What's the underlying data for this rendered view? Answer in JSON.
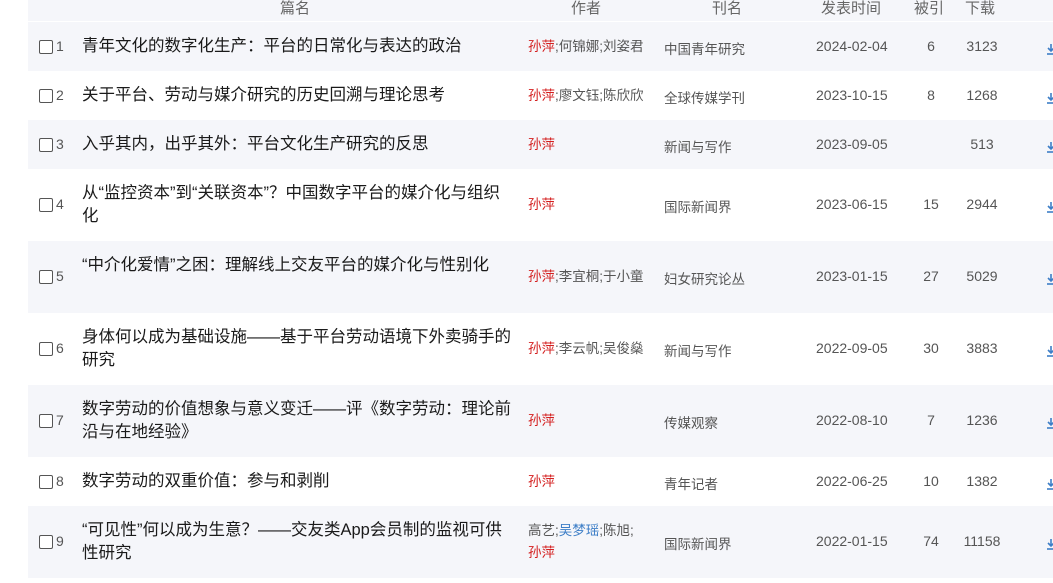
{
  "header": {
    "title": "篇名",
    "authors": "作者",
    "source": "刊名",
    "date": "发表时间",
    "cited": "被引",
    "downloads": "下载"
  },
  "rows": [
    {
      "num": "1",
      "title": "青年文化的数字化生产：平台的日常化与表达的政治",
      "authors": [
        {
          "name": "孙萍",
          "color": "red"
        },
        {
          "name": "何锦娜",
          "color": "gray"
        },
        {
          "name": "刘姿君",
          "color": "gray"
        }
      ],
      "source": "中国青年研究",
      "date": "2024-02-04",
      "cited": "6",
      "downloads": "3123"
    },
    {
      "num": "2",
      "title": "关于平台、劳动与媒介研究的历史回溯与理论思考",
      "authors": [
        {
          "name": "孙萍",
          "color": "red"
        },
        {
          "name": "廖文钰",
          "color": "gray"
        },
        {
          "name": "陈欣欣",
          "color": "gray"
        }
      ],
      "source": "全球传媒学刊",
      "date": "2023-10-15",
      "cited": "8",
      "downloads": "1268"
    },
    {
      "num": "3",
      "title": "入乎其内，出乎其外：平台文化生产研究的反思",
      "authors": [
        {
          "name": "孙萍",
          "color": "red"
        }
      ],
      "source": "新闻与写作",
      "date": "2023-09-05",
      "cited": "",
      "downloads": "513"
    },
    {
      "num": "4",
      "title": "从“监控资本”到“关联资本”？中国数字平台的媒介化与组织化",
      "authors": [
        {
          "name": "孙萍",
          "color": "red"
        }
      ],
      "source": "国际新闻界",
      "date": "2023-06-15",
      "cited": "15",
      "downloads": "2944"
    },
    {
      "num": "5",
      "title": "“中介化爱情”之困：理解线上交友平台的媒介化与性别化",
      "authors": [
        {
          "name": "孙萍",
          "color": "red"
        },
        {
          "name": "李宜桐",
          "color": "gray"
        },
        {
          "name": "于小童",
          "color": "gray"
        }
      ],
      "source": "妇女研究论丛",
      "date": "2023-01-15",
      "cited": "27",
      "downloads": "5029"
    },
    {
      "num": "6",
      "title": "身体何以成为基础设施——基于平台劳动语境下外卖骑手的研究",
      "authors": [
        {
          "name": "孙萍",
          "color": "red"
        },
        {
          "name": "李云帆",
          "color": "gray"
        },
        {
          "name": "吴俊燊",
          "color": "gray"
        }
      ],
      "source": "新闻与写作",
      "date": "2022-09-05",
      "cited": "30",
      "downloads": "3883"
    },
    {
      "num": "7",
      "title": "数字劳动的价值想象与意义变迁——评《数字劳动：理论前沿与在地经验》",
      "authors": [
        {
          "name": "孙萍",
          "color": "red"
        }
      ],
      "source": "传媒观察",
      "date": "2022-08-10",
      "cited": "7",
      "downloads": "1236"
    },
    {
      "num": "8",
      "title": "数字劳动的双重价值：参与和剥削",
      "authors": [
        {
          "name": "孙萍",
          "color": "red"
        }
      ],
      "source": "青年记者",
      "date": "2022-06-25",
      "cited": "10",
      "downloads": "1382"
    },
    {
      "num": "9",
      "title": "“可见性”何以成为生意？——交友类App会员制的监视可供性研究",
      "authors": [
        {
          "name": "高艺",
          "color": "gray"
        },
        {
          "name": "吴梦瑶",
          "color": "blue"
        },
        {
          "name": "陈旭",
          "color": "gray"
        },
        {
          "name": "孙萍",
          "color": "red"
        }
      ],
      "source": "国际新闻界",
      "date": "2022-01-15",
      "cited": "74",
      "downloads": "11158"
    }
  ],
  "icons": {
    "download": "download-icon"
  },
  "colors": {
    "highlight_author": "#d42020",
    "linked_author": "#3d7ec7",
    "row_alt_bg": "#f5f6fa"
  }
}
